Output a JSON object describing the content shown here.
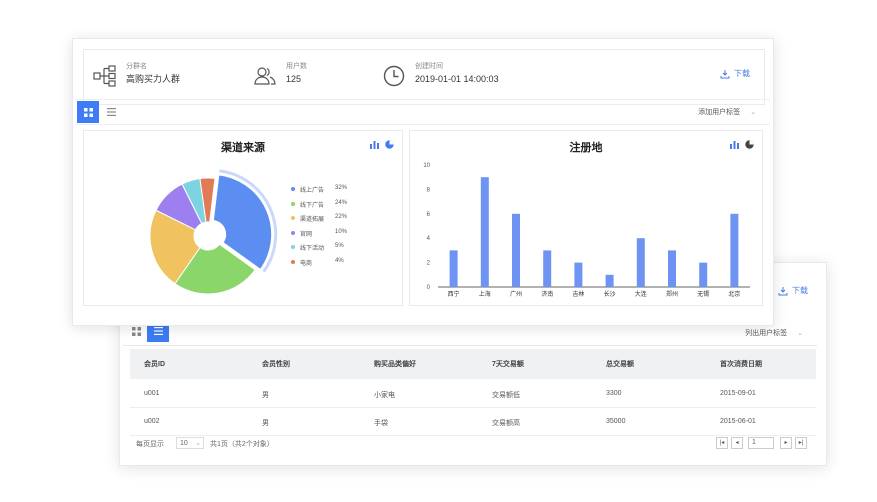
{
  "header": {
    "group_name_label": "分群名",
    "group_name_value": "高购买力人群",
    "user_count_label": "用户数",
    "user_count_value": "125",
    "created_label": "创建时间",
    "created_value": "2019-01-01 14:00:03",
    "download_label": "下载"
  },
  "toolbar": {
    "add_tag_label": "添加用户标签",
    "list_tag_label": "列出用户标签"
  },
  "pie_panel": {
    "title": "渠道来源",
    "legend": [
      {
        "name": "线上广告",
        "pct": "32%",
        "color": "#5b8ef0"
      },
      {
        "name": "线下广告",
        "pct": "24%",
        "color": "#8ad66a"
      },
      {
        "name": "渠道拓展",
        "pct": "22%",
        "color": "#f0c260"
      },
      {
        "name": "官网",
        "pct": "10%",
        "color": "#9d7ff0"
      },
      {
        "name": "线下活动",
        "pct": "5%",
        "color": "#7dd3e0"
      },
      {
        "name": "电商",
        "pct": "4%",
        "color": "#e07b55"
      }
    ]
  },
  "bar_panel": {
    "title": "注册地"
  },
  "chart_data": [
    {
      "type": "pie",
      "title": "渠道来源",
      "categories": [
        "线上广告",
        "线下广告",
        "渠道拓展",
        "官网",
        "线下活动",
        "电商"
      ],
      "values": [
        32,
        24,
        22,
        10,
        5,
        4
      ],
      "colors": [
        "#5b8ef0",
        "#8ad66a",
        "#f0c260",
        "#9d7ff0",
        "#7dd3e0",
        "#e07b55"
      ],
      "legend": "right"
    },
    {
      "type": "bar",
      "title": "注册地",
      "categories": [
        "西宁",
        "上海",
        "广州",
        "济南",
        "吉林",
        "长沙",
        "大连",
        "郑州",
        "无锡",
        "北京"
      ],
      "values": [
        3,
        9,
        6,
        3,
        2,
        1,
        4,
        3,
        2,
        6
      ],
      "ylim": [
        0,
        10
      ],
      "yticks": [
        "0",
        "2",
        "4",
        "6",
        "8",
        "10"
      ],
      "color": "#6f93f2"
    }
  ],
  "table": {
    "columns": [
      "会员ID",
      "会员性别",
      "购买品类偏好",
      "7天交易额",
      "总交易额",
      "首次消费日期"
    ],
    "rows": [
      [
        "u001",
        "男",
        "小家电",
        "交易额低",
        "3300",
        "2015-09-01"
      ],
      [
        "u002",
        "男",
        "手袋",
        "交易额高",
        "35000",
        "2015-06-01"
      ]
    ]
  },
  "pager": {
    "per_page_label": "每页显示",
    "per_page_value": "10",
    "summary": "共1页（共2个对象）",
    "current_page": "1"
  }
}
